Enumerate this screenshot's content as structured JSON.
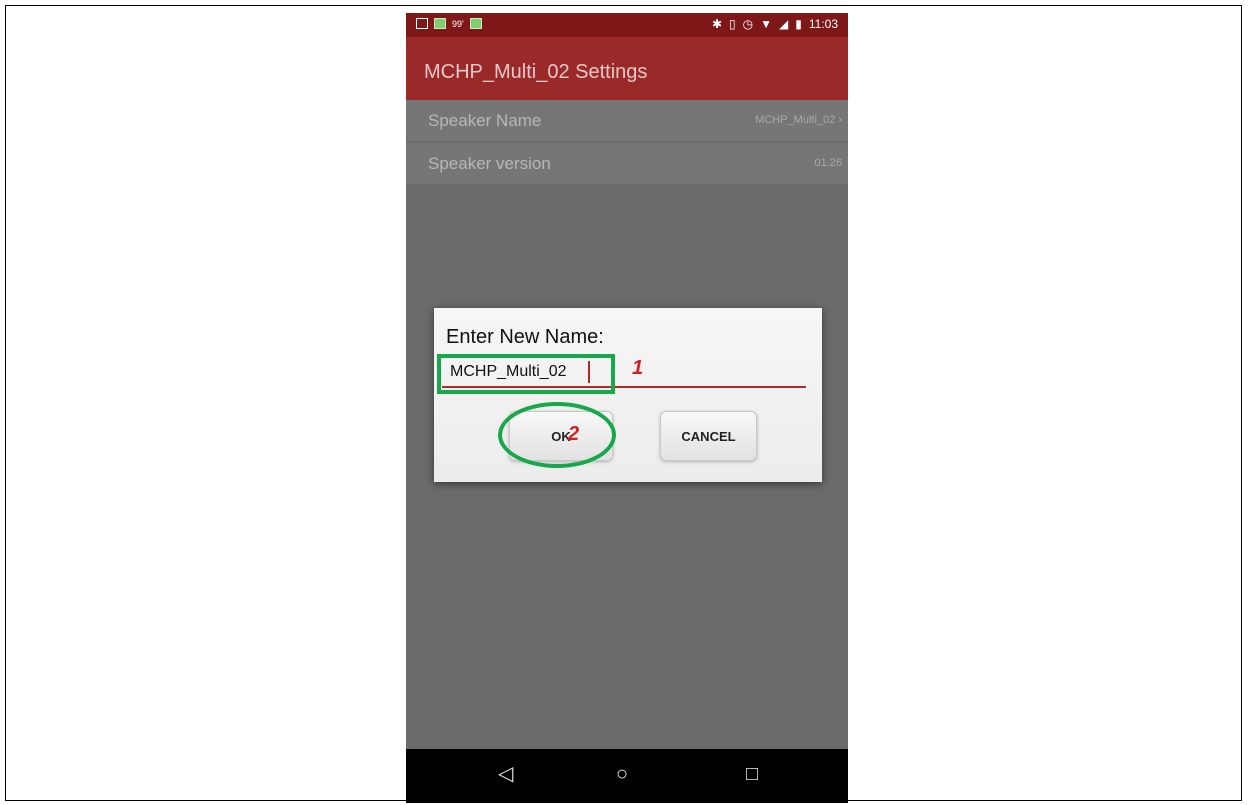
{
  "status_bar": {
    "signal_text": "99'",
    "time": "11:03",
    "right_icons": [
      "bluetooth-icon",
      "vibrate-icon",
      "alarm-icon",
      "wifi-icon",
      "signal-icon",
      "battery-icon"
    ]
  },
  "app_bar": {
    "title": "MCHP_Multi_02 Settings"
  },
  "settings": {
    "rows": [
      {
        "label": "Speaker Name",
        "value": "MCHP_Multi_02",
        "chevron": "›"
      },
      {
        "label": "Speaker version",
        "value": "01.26"
      }
    ]
  },
  "dialog": {
    "title": "Enter New Name:",
    "input_value": "MCHP_Multi_02",
    "ok_label": "OK",
    "cancel_label": "CANCEL"
  },
  "annotations": {
    "marker_1": "1",
    "marker_2": "2"
  },
  "nav_bar": {
    "back": "◁",
    "home": "○",
    "recents": "□"
  },
  "colors": {
    "status_bar": "#7e1718",
    "app_bar": "#9a2a29",
    "accent_red": "#b3292a",
    "highlight_green": "#16a84a",
    "marker_red": "#d11f1f"
  }
}
